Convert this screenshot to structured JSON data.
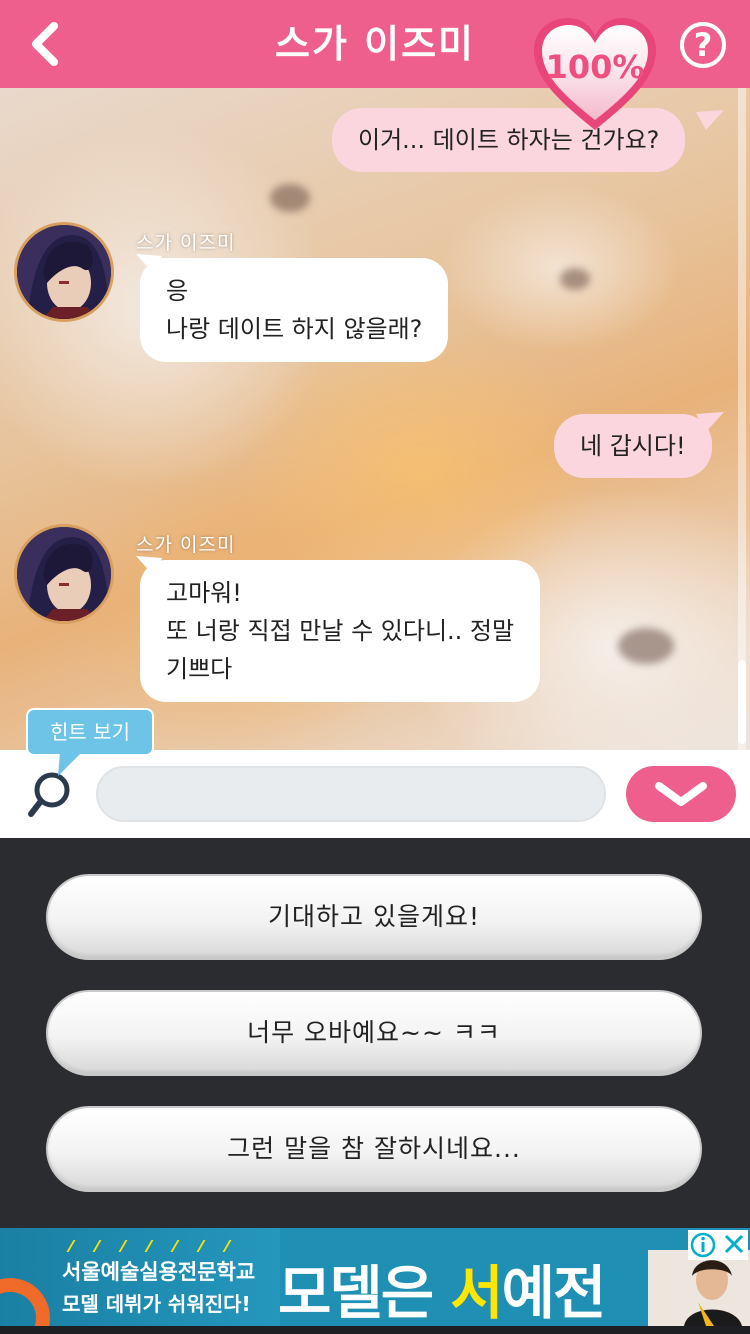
{
  "header": {
    "back_icon": "‹",
    "title": "스가 이즈미",
    "affection": "100%",
    "help": "?"
  },
  "chat": {
    "messages": [
      {
        "from": "me",
        "text": "이거... 데이트 하자는 건가요?"
      },
      {
        "from": "other",
        "name": "스가 이즈미",
        "lines": [
          "응",
          "나랑 데이트 하지 않을래?"
        ]
      },
      {
        "from": "me",
        "text": "네 갑시다!"
      },
      {
        "from": "other",
        "name": "스가 이즈미",
        "lines": [
          "고마워!",
          "또 너랑 직접 만날 수 있다니.. 정말",
          "기쁘다"
        ]
      }
    ]
  },
  "hint": {
    "label": "힌트 보기"
  },
  "input": {
    "value": "",
    "placeholder": ""
  },
  "options": [
    {
      "label": "기대하고 있을게요!"
    },
    {
      "label": "너무 오바예요~~ ㅋㅋ"
    },
    {
      "label": "그런 말을 참 잘하시네요..."
    }
  ],
  "ad": {
    "line1": "서울예술실용전문학교",
    "line2": "모델 데뷔가 쉬워진다!",
    "big_white": "모델은 ",
    "big_yellow": "서",
    "big_white2": "예전",
    "info_icon": "ⓘ",
    "close_icon": "✕"
  }
}
